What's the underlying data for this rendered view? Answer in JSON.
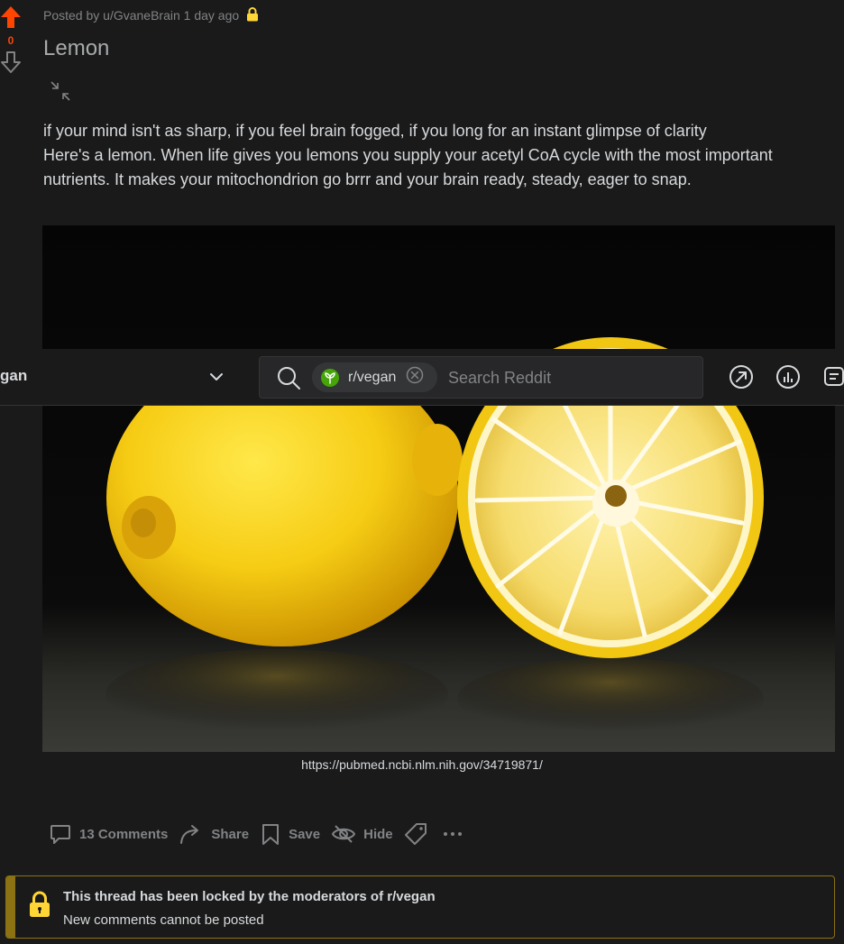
{
  "post": {
    "author_prefix": "Posted by",
    "author": "u/GvaneBrain",
    "time_ago": "1 day ago",
    "title": "Lemon",
    "score": "0",
    "body_lines": [
      "if your mind isn't as sharp, if you feel brain fogged, if you long for an instant glimpse of clarity",
      "Here's a lemon. When life gives you lemons you supply your acetyl CoA cycle with the most important nutrients. It makes your mitochondrion go brrr and your brain ready, steady, eager to snap."
    ],
    "image_alt": "Two lemons on a dark reflective surface, one whole and one cut in half",
    "source_link": "https://pubmed.ncbi.nlm.nih.gov/34719871/"
  },
  "actions": {
    "comments": "13 Comments",
    "share": "Share",
    "save": "Save",
    "hide": "Hide"
  },
  "locked": {
    "title": "This thread has been locked by the moderators of r/vegan",
    "subtitle": "New comments cannot be posted"
  },
  "header": {
    "community_fragment": "gan",
    "chip_label": "r/vegan",
    "search_placeholder": "Search Reddit"
  },
  "colors": {
    "upvote": "#ff4500",
    "lock": "#ffd635",
    "banner_border": "#8c7212",
    "community_green": "#46a508"
  }
}
